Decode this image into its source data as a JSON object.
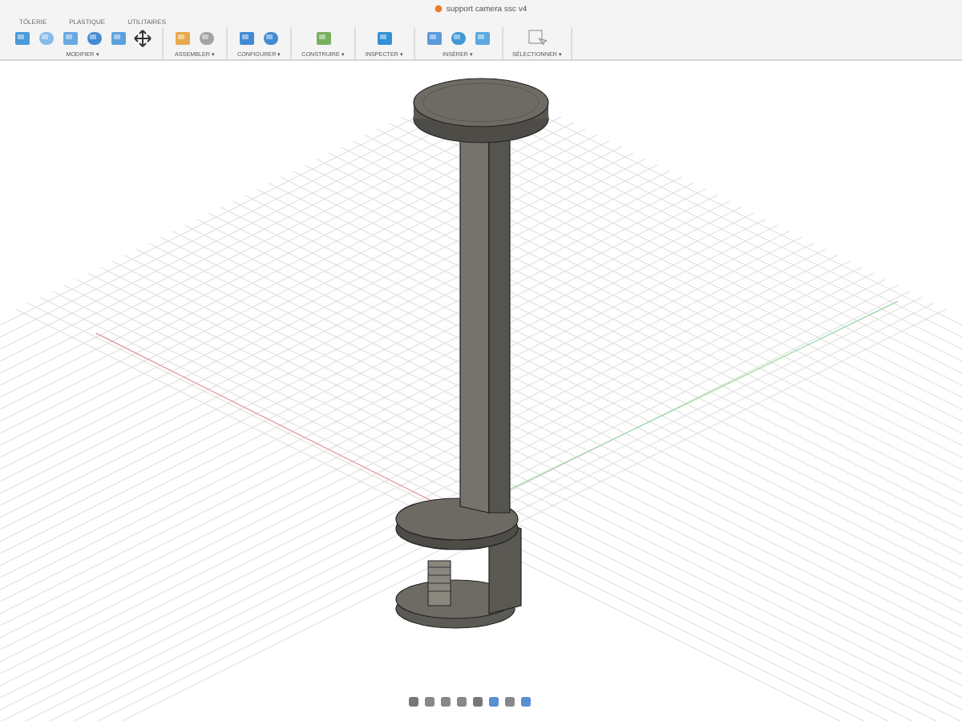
{
  "window": {
    "title": "support camera ssc v4"
  },
  "tabs": [
    {
      "label": "TÔLERIE",
      "selected": false
    },
    {
      "label": "PLASTIQUE",
      "selected": false
    },
    {
      "label": "UTILITAIRES",
      "selected": false
    }
  ],
  "toolbar": {
    "groups": [
      {
        "label": "MODIFIER ▾"
      },
      {
        "label": "ASSEMBLER ▾"
      },
      {
        "label": "CONFIGURER ▾"
      },
      {
        "label": "CONSTRUIRE ▾"
      },
      {
        "label": "INSPECTER ▾"
      },
      {
        "label": "INSÉRER ▾"
      },
      {
        "label": "SÉLECTIONNER ▾"
      }
    ]
  }
}
